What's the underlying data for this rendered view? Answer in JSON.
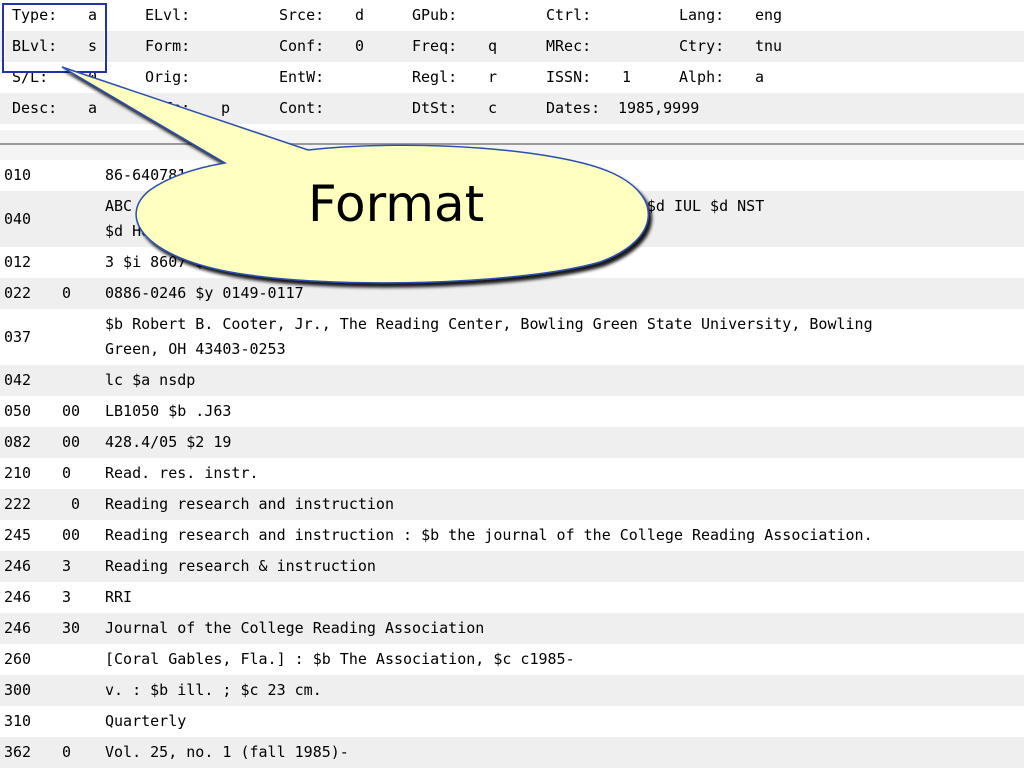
{
  "fixed_fields": [
    [
      {
        "label": "Type:",
        "value": "a"
      },
      {
        "label": "ELvl:",
        "value": ""
      },
      {
        "label": "Srce:",
        "value": "d"
      },
      {
        "label": "GPub:",
        "value": ""
      },
      {
        "label": "Ctrl:",
        "value": ""
      },
      {
        "label": "Lang:",
        "value": "eng"
      }
    ],
    [
      {
        "label": "BLvl:",
        "value": "s"
      },
      {
        "label": "Form:",
        "value": ""
      },
      {
        "label": "Conf:",
        "value": "0"
      },
      {
        "label": "Freq:",
        "value": "q"
      },
      {
        "label": "MRec:",
        "value": ""
      },
      {
        "label": "Ctry:",
        "value": "tnu"
      }
    ],
    [
      {
        "label": "S/L:",
        "value": "0"
      },
      {
        "label": "Orig:",
        "value": ""
      },
      {
        "label": "EntW:",
        "value": ""
      },
      {
        "label": "Regl:",
        "value": "r"
      },
      {
        "label": "ISSN:",
        "value": "1"
      },
      {
        "label": "Alph:",
        "value": "a"
      }
    ],
    [
      {
        "label": "Desc:",
        "value": "a"
      },
      {
        "label": "SrTp:",
        "value": "p"
      },
      {
        "label": "Cont:",
        "value": ""
      },
      {
        "label": "DtSt:",
        "value": "c"
      },
      {
        "label": "Dates:",
        "value": "1985,9999"
      },
      {
        "label": "",
        "value": ""
      }
    ]
  ],
  "variable_fields": [
    {
      "tag": "010",
      "ind": "",
      "data": "86-640781 $z sn 84-1234"
    },
    {
      "tag": "040",
      "ind": "",
      "data": "ABC $c ABC $d NSD $d DLC $d NST $d NSD $d NST $d DLC $d NST $d IUL $d NST\n$d HUL $d NST $d IUL $d NST $d DLC $d OCLCQ"
    },
    {
      "tag": "012",
      "ind": "",
      "data": "3 $i 8607 $k 1 $l 1"
    },
    {
      "tag": "022",
      "ind": "0 ",
      "data": "0886-0246 $y 0149-0117"
    },
    {
      "tag": "037",
      "ind": "",
      "data": "$b Robert B. Cooter, Jr., The Reading Center, Bowling Green State University, Bowling\nGreen, OH 43403-0253"
    },
    {
      "tag": "042",
      "ind": "",
      "data": "lc $a nsdp"
    },
    {
      "tag": "050",
      "ind": "00",
      "data": "LB1050 $b .J63"
    },
    {
      "tag": "082",
      "ind": "00",
      "data": "428.4/05 $2 19"
    },
    {
      "tag": "210",
      "ind": "0 ",
      "data": "Read. res. instr."
    },
    {
      "tag": "222",
      "ind": " 0",
      "data": "Reading research and instruction"
    },
    {
      "tag": "245",
      "ind": "00",
      "data": "Reading research and instruction : $b the journal of the College Reading Association."
    },
    {
      "tag": "246",
      "ind": "3 ",
      "data": "Reading research & instruction"
    },
    {
      "tag": "246",
      "ind": "3 ",
      "data": "RRI"
    },
    {
      "tag": "246",
      "ind": "30",
      "data": "Journal of the College Reading Association"
    },
    {
      "tag": "260",
      "ind": "",
      "data": "[Coral Gables, Fla.] : $b The Association, $c c1985-"
    },
    {
      "tag": "300",
      "ind": "",
      "data": "v. : $b ill. ; $c 23 cm."
    },
    {
      "tag": "310",
      "ind": "",
      "data": "Quarterly"
    },
    {
      "tag": "362",
      "ind": "0 ",
      "data": "Vol. 25, no. 1 (fall 1985)-"
    }
  ],
  "callout": {
    "text": "Format",
    "fill": "#ffffc0",
    "stroke": "#2a4fb0"
  }
}
